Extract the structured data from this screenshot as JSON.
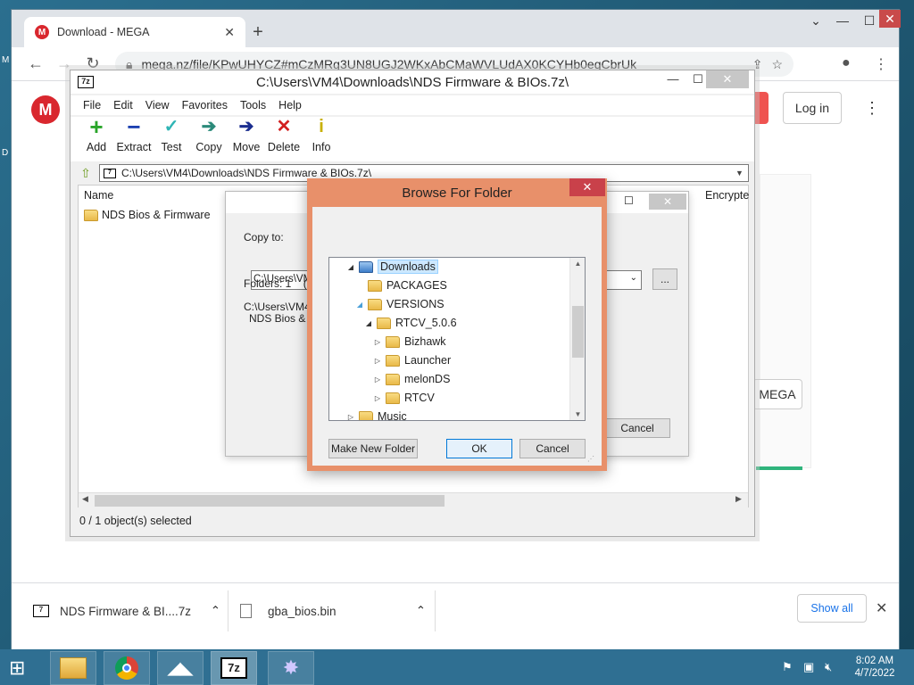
{
  "browser": {
    "tab_title": "Download - MEGA",
    "tab_favicon": "M",
    "url": "mega.nz/file/KPwUHYCZ#mCzMRg3UN8UGJ2WKxAbCMaWVLUdAX0KCYHb0eqCbrUk"
  },
  "mega": {
    "logo": "M",
    "login_label": "Log in",
    "mega_button_label": "MEGA"
  },
  "downloads": [
    {
      "name": "NDS Firmware & BI....7z",
      "icon": "7z-icon"
    },
    {
      "name": "gba_bios.bin",
      "icon": "file-icon"
    }
  ],
  "show_all_label": "Show all",
  "sevenzip": {
    "title": "C:\\Users\\VM4\\Downloads\\NDS Firmware & BIOs.7z\\",
    "menu": [
      "File",
      "Edit",
      "View",
      "Favorites",
      "Tools",
      "Help"
    ],
    "tools": [
      {
        "label": "Add",
        "icon": "add-icon"
      },
      {
        "label": "Extract",
        "icon": "extract-icon"
      },
      {
        "label": "Test",
        "icon": "test-icon"
      },
      {
        "label": "Copy",
        "icon": "copy-icon"
      },
      {
        "label": "Move",
        "icon": "move-icon"
      },
      {
        "label": "Delete",
        "icon": "delete-icon"
      },
      {
        "label": "Info",
        "icon": "info-icon"
      }
    ],
    "address": "C:\\Users\\VM4\\Downloads\\NDS Firmware & BIOs.7z\\",
    "col_name": "Name",
    "col_encrypted": "Encrypte",
    "items": [
      "NDS Bios & Firmware"
    ],
    "status": "0 / 1 object(s) selected"
  },
  "copy_dialog": {
    "copy_to_label": "Copy to:",
    "path_value": "C:\\Users\\VM4\\",
    "folders_text": "Folders: 1",
    "folders_extra": "( 2S",
    "source_line1": "C:\\Users\\VM4\\",
    "source_line2": "NDS Bios & Fir",
    "dots_label": "...",
    "cancel_label": "Cancel"
  },
  "browse": {
    "title": "Browse For Folder",
    "tree": [
      {
        "label": "Downloads",
        "depth": 0,
        "twisty": "open",
        "selected": true,
        "kind": "download"
      },
      {
        "label": "PACKAGES",
        "depth": 1,
        "twisty": "",
        "selected": false,
        "kind": "folder"
      },
      {
        "label": "VERSIONS",
        "depth": 1,
        "twisty": "expanded-light",
        "selected": false,
        "kind": "folder"
      },
      {
        "label": "RTCV_5.0.6",
        "depth": 2,
        "twisty": "open",
        "selected": false,
        "kind": "folder"
      },
      {
        "label": "Bizhawk",
        "depth": 3,
        "twisty": "closed",
        "selected": false,
        "kind": "folder"
      },
      {
        "label": "Launcher",
        "depth": 3,
        "twisty": "closed",
        "selected": false,
        "kind": "folder"
      },
      {
        "label": "melonDS",
        "depth": 3,
        "twisty": "closed",
        "selected": false,
        "kind": "folder"
      },
      {
        "label": "RTCV",
        "depth": 3,
        "twisty": "closed",
        "selected": false,
        "kind": "folder"
      },
      {
        "label": "Music",
        "depth": 0,
        "twisty": "closed",
        "selected": false,
        "kind": "folder"
      }
    ],
    "make_new_folder_label": "Make New Folder",
    "ok_label": "OK",
    "cancel_label": "Cancel"
  },
  "taskbar": {
    "time": "8:02 AM",
    "date": "4/7/2022"
  },
  "colors": {
    "mega_red": "#d9272e",
    "dialog_border": "#e8906a",
    "taskbar": "#2f6f92"
  }
}
